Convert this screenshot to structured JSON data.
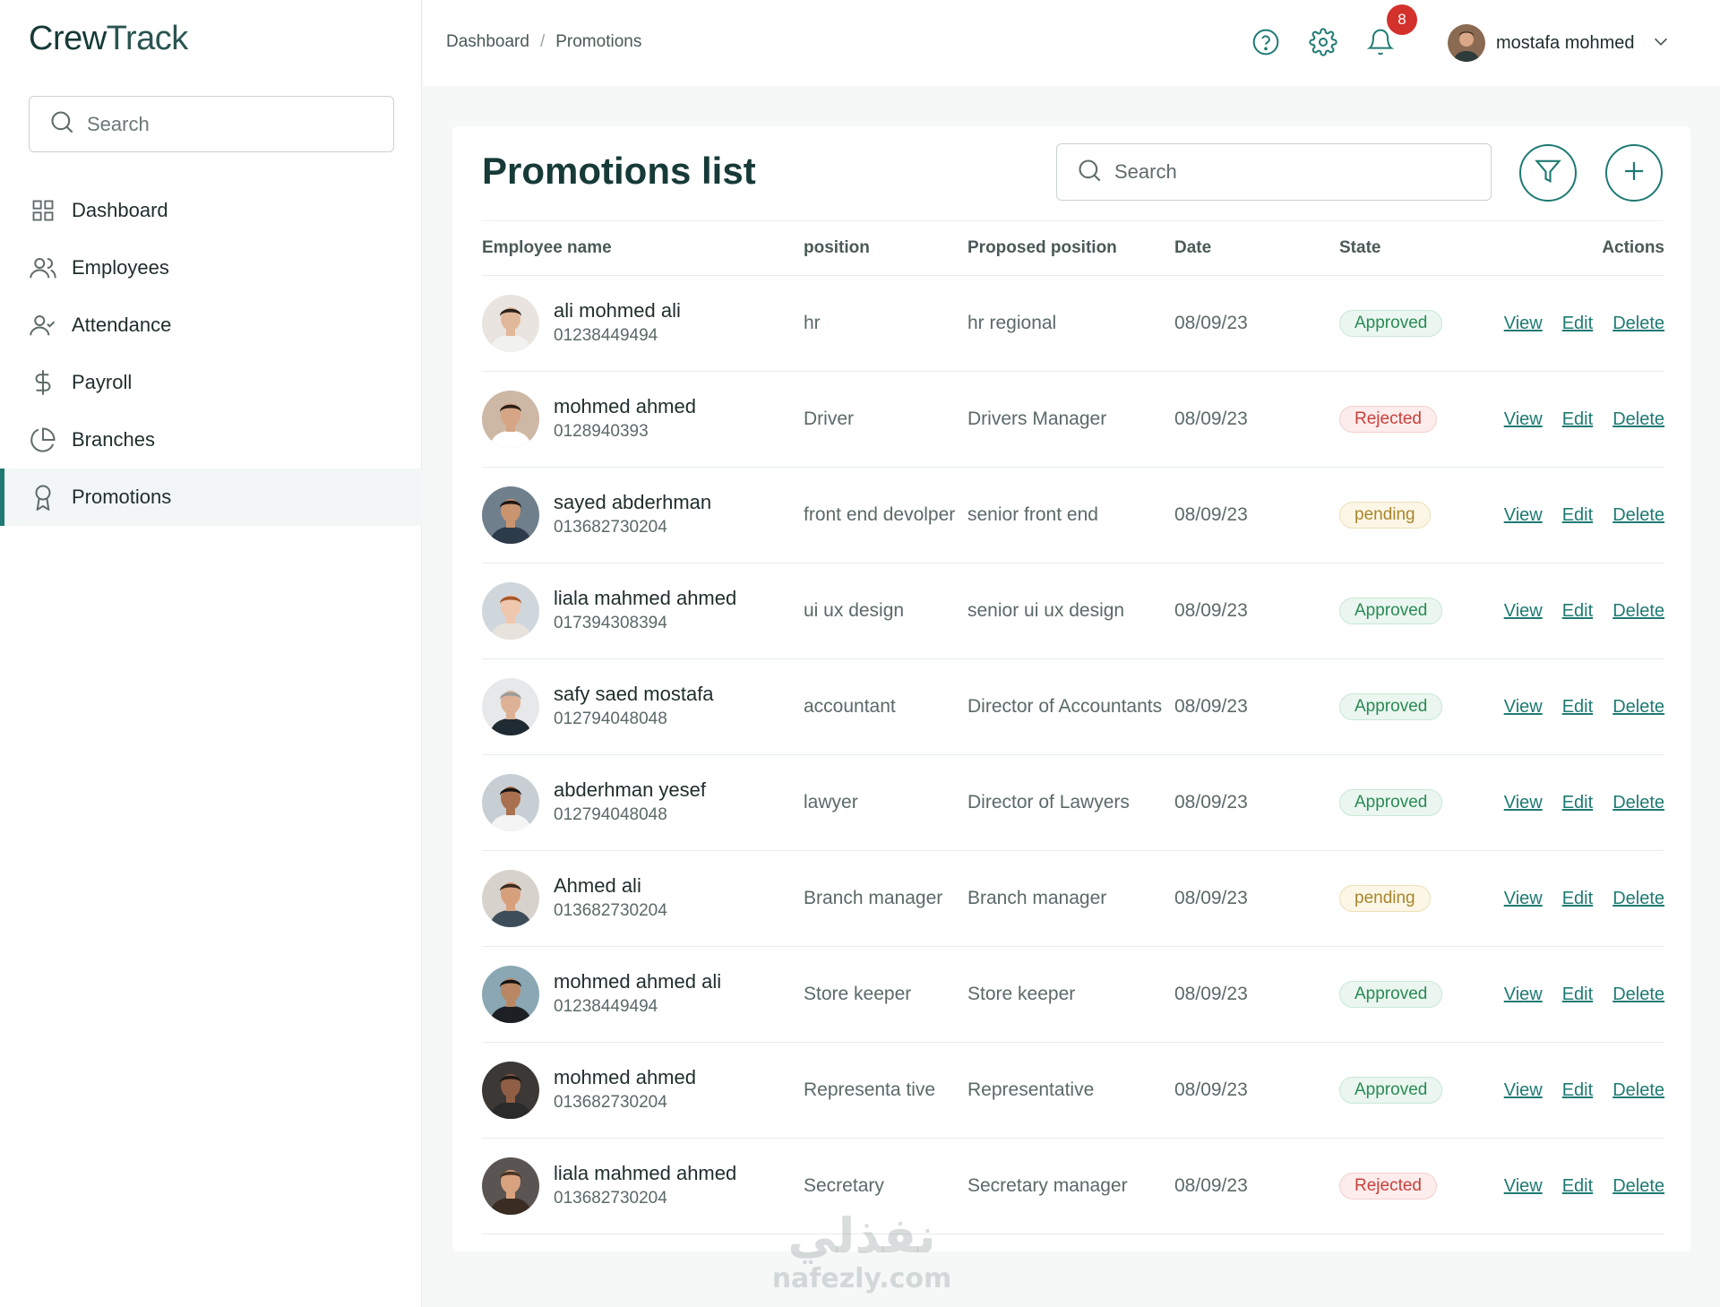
{
  "app": {
    "logo_a": "Crew",
    "logo_b": "Track"
  },
  "sidebar": {
    "search_placeholder": "Search",
    "items": [
      {
        "label": "Dashboard",
        "icon": "grid-icon"
      },
      {
        "label": "Employees",
        "icon": "users-icon"
      },
      {
        "label": "Attendance",
        "icon": "user-check-icon"
      },
      {
        "label": "Payroll",
        "icon": "dollar-icon"
      },
      {
        "label": "Branches",
        "icon": "pie-icon"
      },
      {
        "label": "Promotions",
        "icon": "award-icon",
        "active": true
      }
    ]
  },
  "topbar": {
    "breadcrumb": [
      "Dashboard",
      "Promotions"
    ],
    "breadcrumb_sep": "/",
    "notification_count": "8",
    "user_name": "mostafa mohmed"
  },
  "main": {
    "title": "Promotions list",
    "search_placeholder": "Search",
    "columns": [
      "Employee name",
      "position",
      "Proposed position",
      "Date",
      "State",
      "Actions"
    ],
    "actions": [
      "View",
      "Edit",
      "Delete"
    ],
    "rows": [
      {
        "name": "ali mohmed ali",
        "phone": "01238449494",
        "position": "hr",
        "proposed": "hr regional",
        "date": "08/09/23",
        "state": "Approved"
      },
      {
        "name": "mohmed ahmed",
        "phone": "0128940393",
        "position": "Driver",
        "proposed": "Drivers Manager",
        "date": "08/09/23",
        "state": "Rejected"
      },
      {
        "name": "sayed abderhman",
        "phone": "013682730204",
        "position": "front end devolper",
        "proposed": "senior front end",
        "date": "08/09/23",
        "state": "pending"
      },
      {
        "name": "liala mahmed ahmed",
        "phone": "017394308394",
        "position": "ui ux design",
        "proposed": "senior ui ux design",
        "date": "08/09/23",
        "state": "Approved"
      },
      {
        "name": "safy saed mostafa",
        "phone": "012794048048",
        "position": "accountant",
        "proposed": "Director of Accountants",
        "date": "08/09/23",
        "state": "Approved"
      },
      {
        "name": "abderhman yesef",
        "phone": "012794048048",
        "position": "lawyer",
        "proposed": "Director of Lawyers",
        "date": "08/09/23",
        "state": "Approved"
      },
      {
        "name": "Ahmed ali",
        "phone": "013682730204",
        "position": "Branch manager",
        "proposed": "Branch manager",
        "date": "08/09/23",
        "state": "pending"
      },
      {
        "name": "mohmed ahmed ali",
        "phone": "01238449494",
        "position": "Store keeper",
        "proposed": "Store keeper",
        "date": "08/09/23",
        "state": "Approved"
      },
      {
        "name": "mohmed ahmed",
        "phone": "013682730204",
        "position": "Representa tive",
        "proposed": "Representative",
        "date": "08/09/23",
        "state": "Approved"
      },
      {
        "name": "liala mahmed ahmed",
        "phone": "013682730204",
        "position": "Secretary",
        "proposed": "Secretary manager",
        "date": "08/09/23",
        "state": "Rejected"
      }
    ]
  },
  "watermark": {
    "arabic": "نفذلي",
    "latin": "nafezly.com"
  },
  "colors": {
    "accent": "#1e7a72",
    "approved": "#2a8a55",
    "rejected": "#c9403a",
    "pending": "#a8862c",
    "badge": "#d3312c"
  }
}
